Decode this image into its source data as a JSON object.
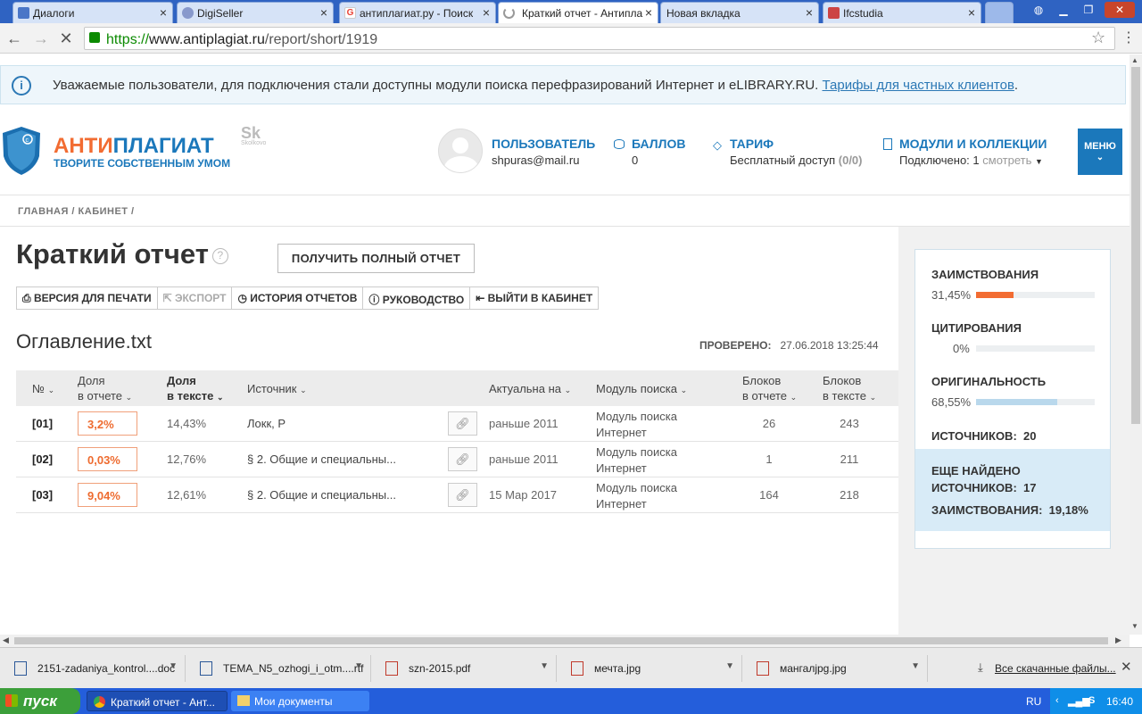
{
  "browser": {
    "tabs": [
      {
        "label": "Диалоги",
        "icon": "chat-icon",
        "color": "#4a76c7"
      },
      {
        "label": "DigiSeller",
        "icon": "digiseller-icon",
        "color": "#8899cc"
      },
      {
        "label": "антиплагиат.ру - Поиск",
        "icon": "google-icon",
        "color": "#e94235"
      },
      {
        "label": "Краткий отчет - Антипла",
        "icon": "loading-icon",
        "color": "#999999"
      },
      {
        "label": "Новая вкладка",
        "icon": "",
        "color": ""
      },
      {
        "label": "Ifcstudia",
        "icon": "site-icon",
        "color": "#cc4444"
      }
    ],
    "url_scheme": "https://",
    "url_host": "www.antiplagiat.ru",
    "url_path": "/report/short/1919"
  },
  "notice": {
    "text": "Уважаемые пользователи, для подключения стали доступны модули поиска перефразирований Интернет и eLIBRARY.RU.",
    "link": "Тарифы для частных клиентов",
    "tail": "."
  },
  "header": {
    "logo_title_a": "АНТИ",
    "logo_title_b": "ПЛАГИАТ",
    "logo_slogan": "ТВОРИТЕ СОБСТВЕННЫМ УМОМ",
    "skolkovo_mark": "Sk",
    "skolkovo_text": "Skolkovo",
    "user_label": "ПОЛЬЗОВАТЕЛЬ",
    "user_value": "shpuras@mail.ru",
    "points_label": "БАЛЛОВ",
    "points_value": "0",
    "tariff_label": "ТАРИФ",
    "tariff_value": "Бесплатный доступ",
    "tariff_count": "(0/0)",
    "modules_label": "МОДУЛИ И КОЛЛЕКЦИИ",
    "modules_value": "Подключено: 1",
    "modules_link": "смотреть",
    "menu_label": "МЕНЮ"
  },
  "breadcrumb": "ГЛАВНАЯ /  КАБИНЕТ /",
  "report": {
    "title": "Краткий отчет",
    "full_report_button": "ПОЛУЧИТЬ ПОЛНЫЙ ОТЧЕТ",
    "tools": [
      {
        "label": "ВЕРСИЯ ДЛЯ ПЕЧАТИ",
        "icon": "printer-icon",
        "enabled": true
      },
      {
        "label": "ЭКСПОРТ",
        "icon": "export-icon",
        "enabled": false
      },
      {
        "label": "ИСТОРИЯ ОТЧЕТОВ",
        "icon": "history-icon",
        "enabled": true
      },
      {
        "label": "РУКОВОДСТВО",
        "icon": "help-icon",
        "enabled": true
      },
      {
        "label": "ВЫЙТИ В КАБИНЕТ",
        "icon": "exit-icon",
        "enabled": true
      }
    ],
    "filename": "Оглавление.txt",
    "checked_label": "ПРОВЕРЕНО:",
    "checked_value": "27.06.2018 13:25:44"
  },
  "table": {
    "headers": {
      "num": "№",
      "share_report_1": "Доля",
      "share_report_2": "в отчете",
      "share_text_1": "Доля",
      "share_text_2": "в тексте",
      "source": "Источник",
      "actual": "Актуальна на",
      "module": "Модуль поиска",
      "blocks_report_1": "Блоков",
      "blocks_report_2": "в отчете",
      "blocks_text_1": "Блоков",
      "blocks_text_2": "в тексте"
    },
    "rows": [
      {
        "num": "[01]",
        "share_report": "3,2%",
        "share_text": "14,43%",
        "source": "Локк, Р",
        "actual": "раньше 2011",
        "module_1": "Модуль поиска",
        "module_2": "Интернет",
        "blocks_report": "26",
        "blocks_text": "243"
      },
      {
        "num": "[02]",
        "share_report": "0,03%",
        "share_text": "12,76%",
        "source": "§ 2. Общие и специальны...",
        "actual": "раньше 2011",
        "module_1": "Модуль поиска",
        "module_2": "Интернет",
        "blocks_report": "1",
        "blocks_text": "211"
      },
      {
        "num": "[03]",
        "share_report": "9,04%",
        "share_text": "12,61%",
        "source": "§ 2. Общие и специальны...",
        "actual": "15 Мар 2017",
        "module_1": "Модуль поиска",
        "module_2": "Интернет",
        "blocks_report": "164",
        "blocks_text": "218"
      }
    ]
  },
  "stats": {
    "borrow_label": "ЗАИМСТВОВАНИЯ",
    "borrow_value": "31,45%",
    "borrow_fraction": 0.3145,
    "borrow_color": "#f26c32",
    "cite_label": "ЦИТИРОВАНИЯ",
    "cite_value": "0%",
    "cite_fraction": 0,
    "cite_color": "#3ea555",
    "orig_label": "ОРИГИНАЛЬНОСТЬ",
    "orig_value": "68,55%",
    "orig_fraction": 0.6855,
    "orig_color": "#b9d8ec",
    "sources_label": "ИСТОЧНИКОВ:",
    "sources_value": "20",
    "more_label_1": "ЕЩЕ НАЙДЕНО",
    "more_label_2": "ИСТОЧНИКОВ:",
    "more_sources_value": "17",
    "more_borrow_label": "ЗАИМСТВОВАНИЯ:",
    "more_borrow_value": "19,18%"
  },
  "downloads": {
    "items": [
      {
        "name": "2151-zadaniya_kontrol....doc",
        "icon": "word-icon",
        "color": "#2b5797"
      },
      {
        "name": "TEMA_N5_ozhogi_i_otm....rtf",
        "icon": "word-icon",
        "color": "#2b5797"
      },
      {
        "name": "szn-2015.pdf",
        "icon": "pdf-icon",
        "color": "#c0392b"
      },
      {
        "name": "мечта.jpg",
        "icon": "image-icon",
        "color": "#c0392b"
      },
      {
        "name": "мангалjpg.jpg",
        "icon": "image-icon",
        "color": "#c0392b"
      }
    ],
    "all_files": "Все скачанные файлы..."
  },
  "taskbar": {
    "start": "пуск",
    "tasks": [
      "Краткий отчет - Ант...",
      "Мои документы"
    ],
    "lang": "RU",
    "clock": "16:40"
  }
}
